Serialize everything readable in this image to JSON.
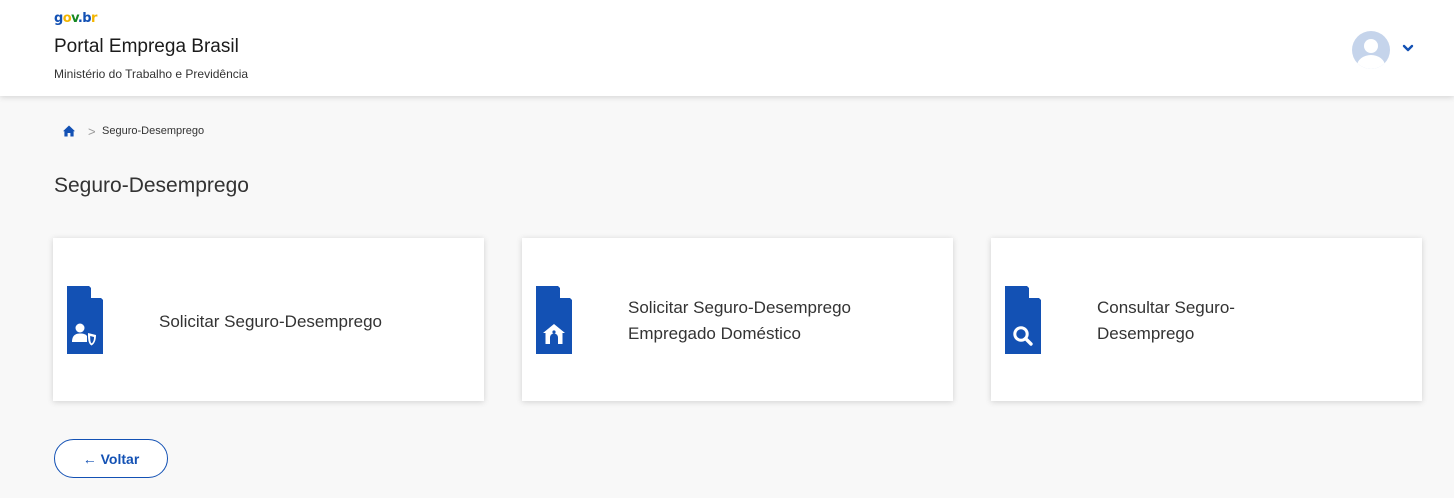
{
  "header": {
    "logo_text": "gov.br",
    "portal_title": "Portal Emprega Brasil",
    "ministry": "Ministério do Trabalho e Previdência"
  },
  "breadcrumb": {
    "home_icon": "home-icon",
    "separator": ">",
    "current": "Seguro-Desemprego"
  },
  "page": {
    "title": "Seguro-Desemprego"
  },
  "cards": [
    {
      "label": "Solicitar Seguro-Desemprego",
      "icon": "document-user-shield-icon"
    },
    {
      "label": "Solicitar Seguro-Desemprego Empregado Doméstico",
      "icon": "document-house-icon"
    },
    {
      "label": "Consultar Seguro-Desemprego",
      "icon": "document-search-icon"
    }
  ],
  "buttons": {
    "back_label": "← Voltar"
  },
  "colors": {
    "primary": "#1351b4",
    "background": "#f8f8f8",
    "card": "#ffffff"
  }
}
